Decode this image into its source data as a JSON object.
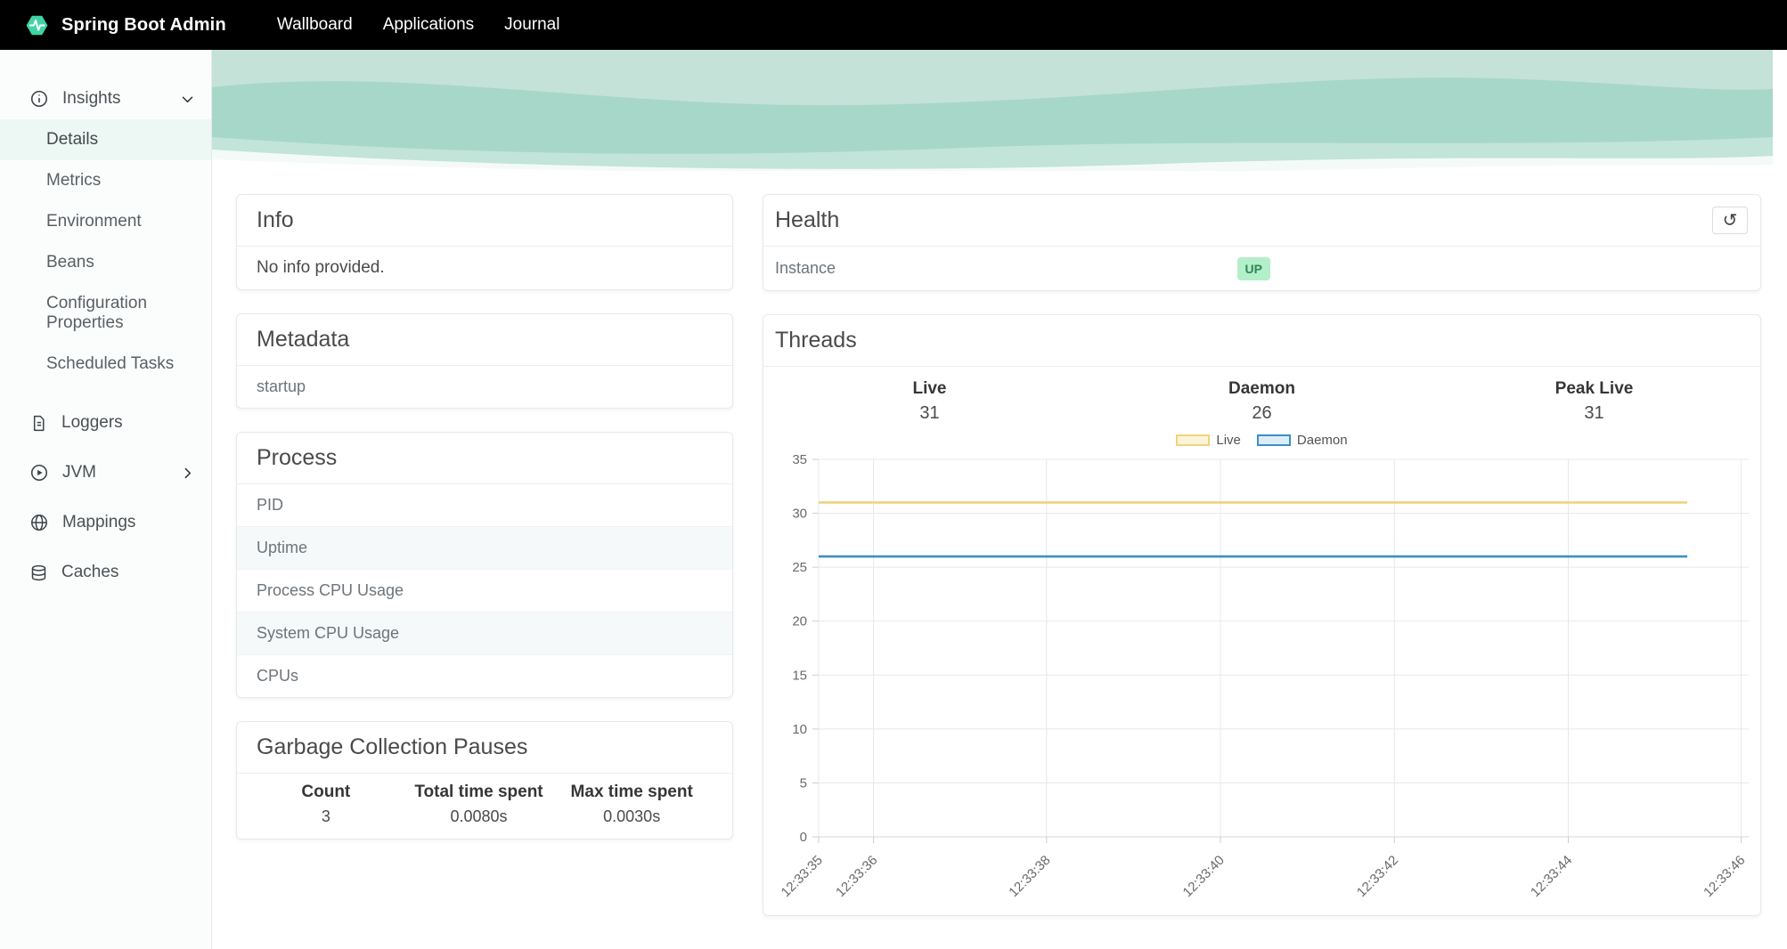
{
  "navbar": {
    "brand": "Spring Boot Admin",
    "items": [
      {
        "label": "Wallboard"
      },
      {
        "label": "Applications"
      },
      {
        "label": "Journal"
      }
    ]
  },
  "sidebar": {
    "items": [
      {
        "label": "Insights"
      },
      {
        "label": "Details",
        "active": true
      },
      {
        "label": "Metrics"
      },
      {
        "label": "Environment"
      },
      {
        "label": "Beans"
      },
      {
        "label": "Configuration Properties"
      },
      {
        "label": "Scheduled Tasks"
      },
      {
        "label": "Loggers"
      },
      {
        "label": "JVM"
      },
      {
        "label": "Mappings"
      },
      {
        "label": "Caches"
      }
    ]
  },
  "info_panel": {
    "title": "Info",
    "empty_message": "No info provided."
  },
  "metadata_panel": {
    "title": "Metadata",
    "rows": [
      "startup"
    ]
  },
  "process_panel": {
    "title": "Process",
    "rows": [
      "PID",
      "Uptime",
      "Process CPU Usage",
      "System CPU Usage",
      "CPUs"
    ]
  },
  "gc_panel": {
    "title": "Garbage Collection Pauses",
    "columns": [
      {
        "header": "Count",
        "value": "3"
      },
      {
        "header": "Total time spent",
        "value": "0.0080s"
      },
      {
        "header": "Max time spent",
        "value": "0.0030s"
      }
    ]
  },
  "health_panel": {
    "title": "Health",
    "action_icon": "history",
    "action_glyph": "↺",
    "rows": [
      {
        "label": "Instance",
        "status": "UP"
      }
    ],
    "status_colors": {
      "bg": "#b3efc9",
      "text": "#2f855a"
    }
  },
  "threads_panel": {
    "title": "Threads",
    "stats": [
      {
        "label": "Live",
        "value": "31"
      },
      {
        "label": "Daemon",
        "value": "26"
      },
      {
        "label": "Peak Live",
        "value": "31"
      }
    ]
  },
  "chart_data": {
    "type": "line",
    "title": "Threads",
    "x_axis": {
      "ticks": [
        "12:33:35",
        "12:33:36",
        "12:33:38",
        "12:33:40",
        "12:33:42",
        "12:33:44",
        "12:33:46"
      ],
      "tick_positions": [
        0,
        0.059,
        0.245,
        0.432,
        0.619,
        0.806,
        0.992
      ]
    },
    "y_axis": {
      "min": 0,
      "max": 35,
      "step": 5
    },
    "series": [
      {
        "name": "Live",
        "value": 31,
        "start": "12:33:35",
        "end": "12:33:45",
        "color": "#f0d37b",
        "legend_fill": "#fbf4da"
      },
      {
        "name": "Daemon",
        "value": 26,
        "start": "12:33:35",
        "end": "12:33:45",
        "color": "#3e8ec4",
        "legend_fill": "#ddedf8"
      }
    ],
    "data_end_position": 0.934,
    "grid": true,
    "legend_position": "top-center"
  },
  "theme": {
    "brand_green": "#42d3a5",
    "navbar_bg": "#000000"
  }
}
